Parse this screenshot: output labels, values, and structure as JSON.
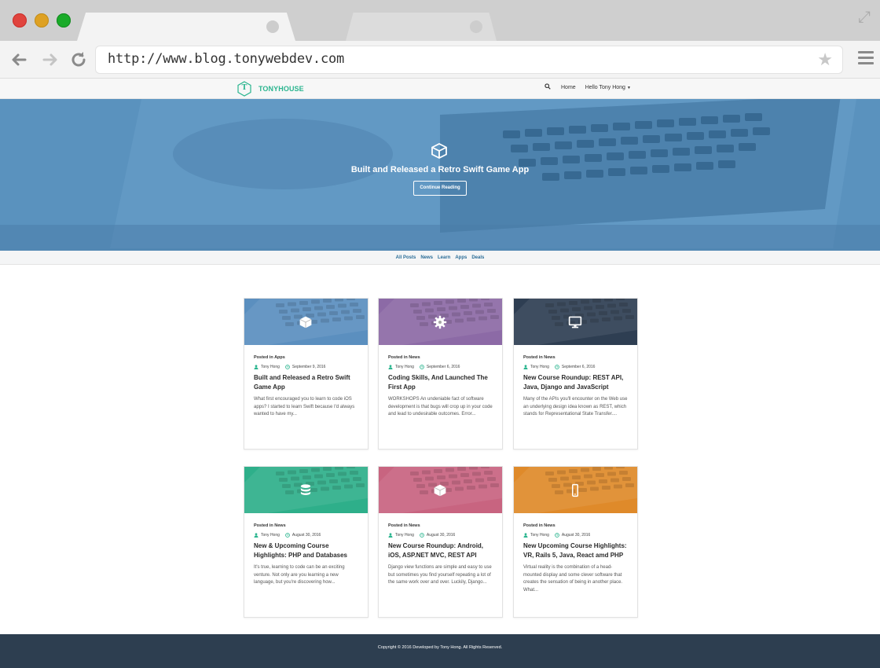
{
  "browser": {
    "url": "http://www.blog.tonywebdev.com"
  },
  "site": {
    "logo_letter": "T",
    "name": "TONYHOUSE",
    "nav": {
      "home": "Home",
      "user": "Hello Tony Hong"
    }
  },
  "hero": {
    "title": "Built and Released a Retro Swift Game App",
    "button": "Continue Reading"
  },
  "categories": [
    "All Posts",
    "News",
    "Learn",
    "Apps",
    "Deals"
  ],
  "posts": [
    {
      "posted_in": "Posted in Apps",
      "author": "Tony Hong",
      "date": "September 9, 2016",
      "title": "Built and Released a Retro Swift Game App",
      "excerpt": "What first encouraged you to learn to code iOS apps? I started to learn Swift because I'd always wanted to have my...",
      "icon": "cube-icon",
      "color": "#5b8fbf"
    },
    {
      "posted_in": "Posted in News",
      "author": "Tony Hong",
      "date": "September 6, 2016",
      "title": "Coding Skills, And Launched The First App",
      "excerpt": "WORKSHOPS An undeniable fact of software development is that bugs will crop up in your code and lead to undesirable outcomes. Error...",
      "icon": "gear-icon",
      "color": "#8c6aa6"
    },
    {
      "posted_in": "Posted in News",
      "author": "Tony Hong",
      "date": "September 6, 2016",
      "title": "New Course Roundup: REST API, Java, Django and JavaScript",
      "excerpt": "Many of the APIs you'll encounter on the Web use an underlying design idea known as REST, which stands for Representational State Transfer....",
      "icon": "desktop-icon",
      "color": "#2f3e52"
    },
    {
      "posted_in": "Posted in News",
      "author": "Tony Hong",
      "date": "August 30, 2016",
      "title": "New & Upcoming Course Highlights: PHP and Databases",
      "excerpt": "It's true, learning to code can be an exciting venture. Not only are you learning a new language, but you're discovering how...",
      "icon": "database-icon",
      "color": "#2fb08a"
    },
    {
      "posted_in": "Posted in News",
      "author": "Tony Hong",
      "date": "August 30, 2016",
      "title": "New Course Roundup: Android, iOS, ASP.NET MVC, REST API",
      "excerpt": "Django view functions are simple and easy to use but sometimes you find yourself repeating a lot of the same work over and over. Luckily, Django...",
      "icon": "cube-icon",
      "color": "#c86480"
    },
    {
      "posted_in": "Posted in News",
      "author": "Tony Hong",
      "date": "August 30, 2016",
      "title": "New Upcoming Course Highlights: VR, Rails 5, Java, React amd PHP",
      "excerpt": "Virtual reality is the combination of a head-mounted display and some clever software that creates the sensation of being in another place. What...",
      "icon": "mobile-icon",
      "color": "#df8a2a"
    }
  ],
  "footer": {
    "copyright": "Copyright © 2016 Developed by Tony Hong. All Rights Reserved."
  }
}
